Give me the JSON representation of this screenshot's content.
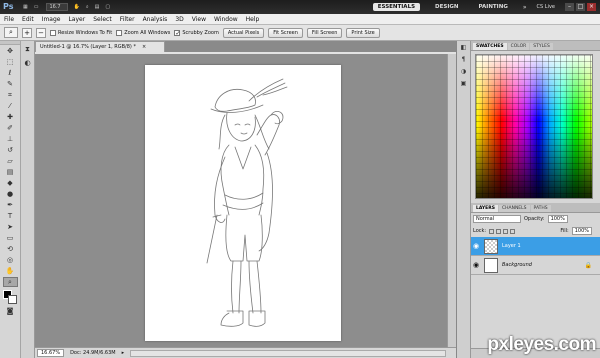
{
  "app": {
    "logo": "Ps",
    "zoom": "16.7",
    "workspaces": [
      "ESSENTIALS",
      "DESIGN",
      "PAINTING"
    ],
    "cslive": "CS Live",
    "more": "»"
  },
  "menu": [
    "File",
    "Edit",
    "Image",
    "Layer",
    "Select",
    "Filter",
    "Analysis",
    "3D",
    "View",
    "Window",
    "Help"
  ],
  "options": {
    "resize_windows": "Resize Windows To Fit",
    "zoom_all": "Zoom All Windows",
    "scrubby_zoom": "Scrubby Zoom",
    "actual_pixels": "Actual Pixels",
    "fit_screen": "Fit Screen",
    "fill_screen": "Fill Screen",
    "print_size": "Print Size"
  },
  "document": {
    "tab_title": "Untitled-1 @ 16.7% (Layer 1, RGB/8) *",
    "close": "×",
    "zoom_field": "16.67%",
    "doc_info": "Doc: 24.9M/6.63M"
  },
  "swatches_tabs": [
    "SWATCHES",
    "COLOR",
    "STYLES"
  ],
  "layers_tabs": [
    "LAYERS",
    "CHANNELS",
    "PATHS"
  ],
  "layers": {
    "blend_mode": "Normal",
    "opacity_label": "Opacity:",
    "opacity_value": "100%",
    "lock_label": "Lock:",
    "fill_label": "Fill:",
    "fill_value": "100%",
    "items": [
      {
        "name": "Layer 1",
        "active": true
      },
      {
        "name": "Background",
        "active": false
      }
    ]
  },
  "watermark": "pxleyes.com",
  "colors": {
    "accent": "#3b9ee6",
    "chrome_dark": "#1d1d1d"
  }
}
